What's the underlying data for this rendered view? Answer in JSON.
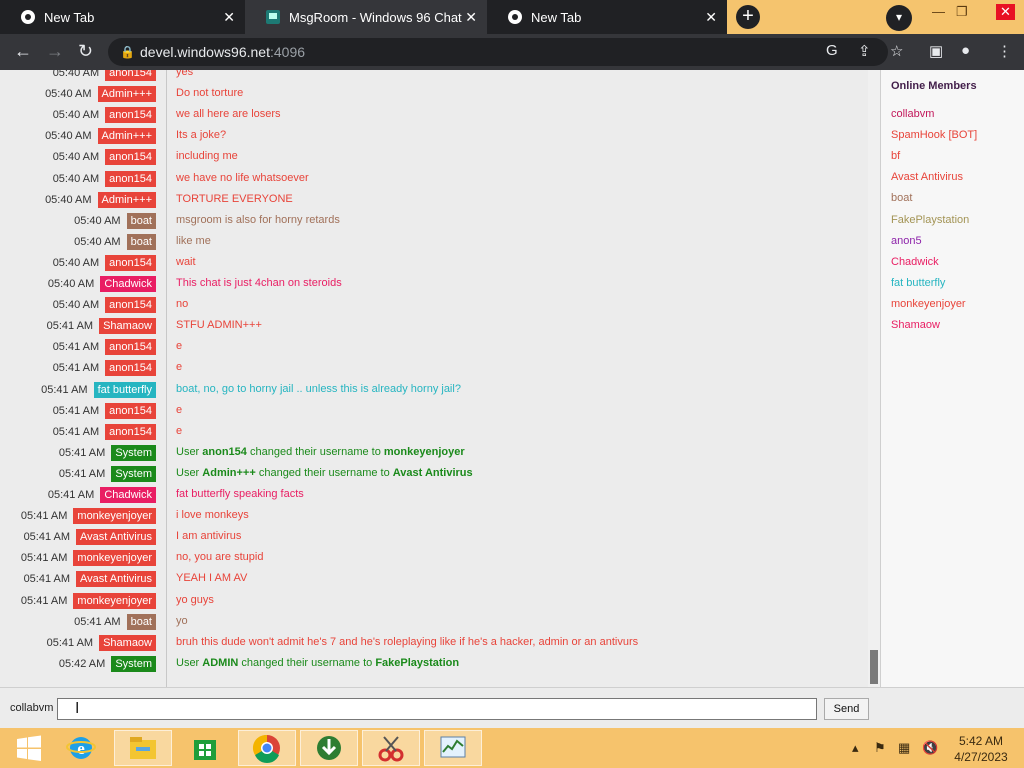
{
  "browser": {
    "tabs": [
      {
        "title": "New Tab",
        "active": false
      },
      {
        "title": "MsgRoom - Windows 96 Chat",
        "active": true
      },
      {
        "title": "New Tab",
        "active": false
      }
    ],
    "url_host": "devel.windows96.net",
    "url_port": ":4096"
  },
  "colors": {
    "red_user": "#e8443a",
    "pink_user": "#e91e63",
    "cyan_user": "#26b5c1",
    "brown_user": "#a1715a",
    "system": "#1b8a1b"
  },
  "chat": {
    "messages": [
      {
        "time": "05:40 AM",
        "user": "anon154",
        "color": "#e8443a",
        "text": "yes"
      },
      {
        "time": "05:40 AM",
        "user": "Admin+++",
        "color": "#e8443a",
        "text": "Do not torture"
      },
      {
        "time": "05:40 AM",
        "user": "anon154",
        "color": "#e8443a",
        "text": "we all here are losers"
      },
      {
        "time": "05:40 AM",
        "user": "Admin+++",
        "color": "#e8443a",
        "text": "Its a joke?"
      },
      {
        "time": "05:40 AM",
        "user": "anon154",
        "color": "#e8443a",
        "text": "including me"
      },
      {
        "time": "05:40 AM",
        "user": "anon154",
        "color": "#e8443a",
        "text": "we have no life whatsoever"
      },
      {
        "time": "05:40 AM",
        "user": "Admin+++",
        "color": "#e8443a",
        "text": "TORTURE EVERYONE"
      },
      {
        "time": "05:40 AM",
        "user": "boat",
        "color": "#a1715a",
        "text": "msgroom is also for horny retards"
      },
      {
        "time": "05:40 AM",
        "user": "boat",
        "color": "#a1715a",
        "text": "like me"
      },
      {
        "time": "05:40 AM",
        "user": "anon154",
        "color": "#e8443a",
        "text": "wait"
      },
      {
        "time": "05:40 AM",
        "user": "Chadwick",
        "color": "#e91e63",
        "text": "This chat is just 4chan on steroids"
      },
      {
        "time": "05:40 AM",
        "user": "anon154",
        "color": "#e8443a",
        "text": "no"
      },
      {
        "time": "05:41 AM",
        "user": "Shamaow",
        "color": "#e8443a",
        "text": "STFU ADMIN+++"
      },
      {
        "time": "05:41 AM",
        "user": "anon154",
        "color": "#e8443a",
        "text": "e"
      },
      {
        "time": "05:41 AM",
        "user": "anon154",
        "color": "#e8443a",
        "text": "e"
      },
      {
        "time": "05:41 AM",
        "user": "fat butterfly",
        "color": "#26b5c1",
        "text": "boat, no, go to horny jail .. unless this is already horny jail?"
      },
      {
        "time": "05:41 AM",
        "user": "anon154",
        "color": "#e8443a",
        "text": "e"
      },
      {
        "time": "05:41 AM",
        "user": "anon154",
        "color": "#e8443a",
        "text": "e"
      },
      {
        "time": "05:41 AM",
        "user": "System",
        "color": "#1b8a1b",
        "system": true,
        "pre": "User ",
        "b1": "anon154",
        "mid": " changed their username to ",
        "b2": "monkeyenjoyer"
      },
      {
        "time": "05:41 AM",
        "user": "System",
        "color": "#1b8a1b",
        "system": true,
        "pre": "User ",
        "b1": "Admin+++",
        "mid": " changed their username to ",
        "b2": "Avast Antivirus"
      },
      {
        "time": "05:41 AM",
        "user": "Chadwick",
        "color": "#e91e63",
        "text": "fat butterfly speaking facts"
      },
      {
        "time": "05:41 AM",
        "user": "monkeyenjoyer",
        "color": "#e8443a",
        "text": "i love monkeys"
      },
      {
        "time": "05:41 AM",
        "user": "Avast Antivirus",
        "color": "#e8443a",
        "text": "I am antivirus"
      },
      {
        "time": "05:41 AM",
        "user": "monkeyenjoyer",
        "color": "#e8443a",
        "text": "no, you are stupid"
      },
      {
        "time": "05:41 AM",
        "user": "Avast Antivirus",
        "color": "#e8443a",
        "text": "YEAH I AM AV"
      },
      {
        "time": "05:41 AM",
        "user": "monkeyenjoyer",
        "color": "#e8443a",
        "text": "yo guys"
      },
      {
        "time": "05:41 AM",
        "user": "boat",
        "color": "#a1715a",
        "text": "yo"
      },
      {
        "time": "05:41 AM",
        "user": "Shamaow",
        "color": "#e8443a",
        "text": "bruh this dude won't admit he's 7 and he's roleplaying like if he's a hacker, admin or an antivurs"
      },
      {
        "time": "05:42 AM",
        "user": "System",
        "color": "#1b8a1b",
        "system": true,
        "pre": "User ",
        "b1": "ADMIN",
        "mid": " changed their username to ",
        "b2": "FakePlaystation"
      }
    ]
  },
  "members": {
    "title": "Online Members",
    "list": [
      {
        "name": "collabvm",
        "color": "#c2185b"
      },
      {
        "name": "SpamHook [BOT]",
        "color": "#e8443a"
      },
      {
        "name": "bf",
        "color": "#e8443a"
      },
      {
        "name": "Avast Antivirus",
        "color": "#e8443a"
      },
      {
        "name": "boat",
        "color": "#a1715a"
      },
      {
        "name": "FakePlaystation",
        "color": "#a39455"
      },
      {
        "name": "anon5",
        "color": "#8e24aa"
      },
      {
        "name": "Chadwick",
        "color": "#e91e63"
      },
      {
        "name": "fat butterfly",
        "color": "#26b5c1"
      },
      {
        "name": "monkeyenjoyer",
        "color": "#e8443a"
      },
      {
        "name": "Shamaow",
        "color": "#e91e63"
      }
    ]
  },
  "input": {
    "nickname": "collabvm",
    "value": "",
    "send_label": "Send"
  },
  "taskbar": {
    "time": "5:42 AM",
    "date": "4/27/2023",
    "apps": [
      "start-button",
      "internet-explorer-icon",
      "file-explorer-icon",
      "store-icon",
      "chrome-icon",
      "download-manager-icon",
      "snipping-tool-icon",
      "task-manager-icon"
    ]
  }
}
